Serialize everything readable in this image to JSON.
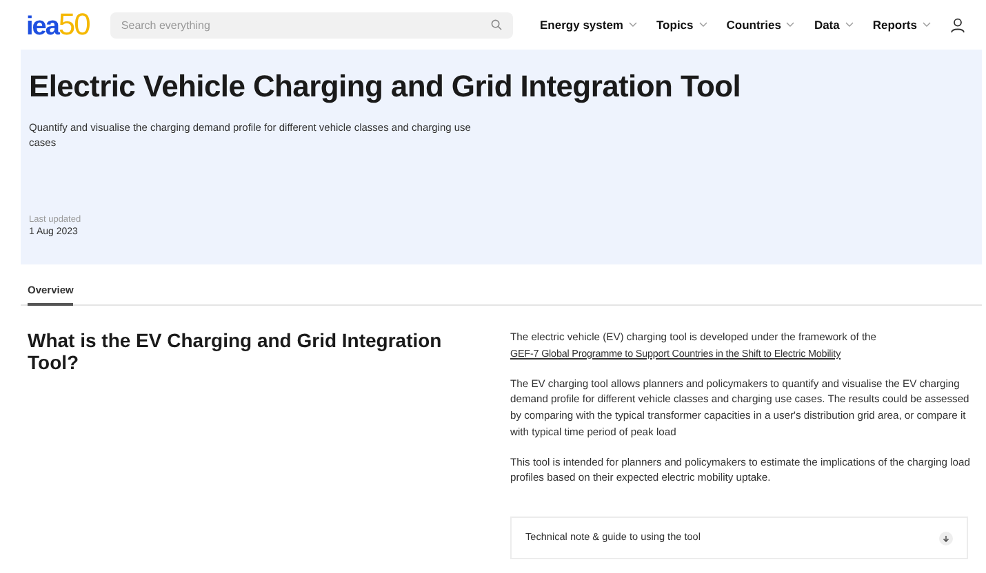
{
  "header": {
    "logo": {
      "text": "iea",
      "accent": "50"
    },
    "search": {
      "placeholder": "Search everything"
    },
    "menu": [
      {
        "label": "Energy system"
      },
      {
        "label": "Topics"
      },
      {
        "label": "Countries"
      },
      {
        "label": "Data"
      },
      {
        "label": "Reports"
      }
    ]
  },
  "hero": {
    "title": "Electric Vehicle Charging and Grid Integration Tool",
    "subtitle": "Quantify and visualise the charging demand profile for different vehicle classes and charging use cases",
    "updated_label": "Last updated",
    "updated_date": "1 Aug 2023"
  },
  "tabs": [
    {
      "label": "Overview",
      "selected": true
    }
  ],
  "section": {
    "heading": "What is the EV Charging and Grid Integration Tool?",
    "paragraphs": [
      {
        "text": "The electric vehicle (EV) charging tool is developed under the framework of the",
        "link": "GEF-7 Global Programme to Support Countries in the Shift to Electric Mobility"
      },
      {
        "text": "The EV charging tool allows planners and policymakers to quantify and visualise the EV charging demand profile for different vehicle classes and charging use cases. The results could be assessed by comparing with the typical transformer capacities in a user's distribution grid area, or compare it with typical time period of peak load"
      },
      {
        "text": "This tool is intended for planners and policymakers to estimate the implications of the charging load profiles based on their expected electric mobility uptake."
      }
    ],
    "accordion": {
      "label": "Technical note & guide to using the tool",
      "expanded": false
    }
  }
}
